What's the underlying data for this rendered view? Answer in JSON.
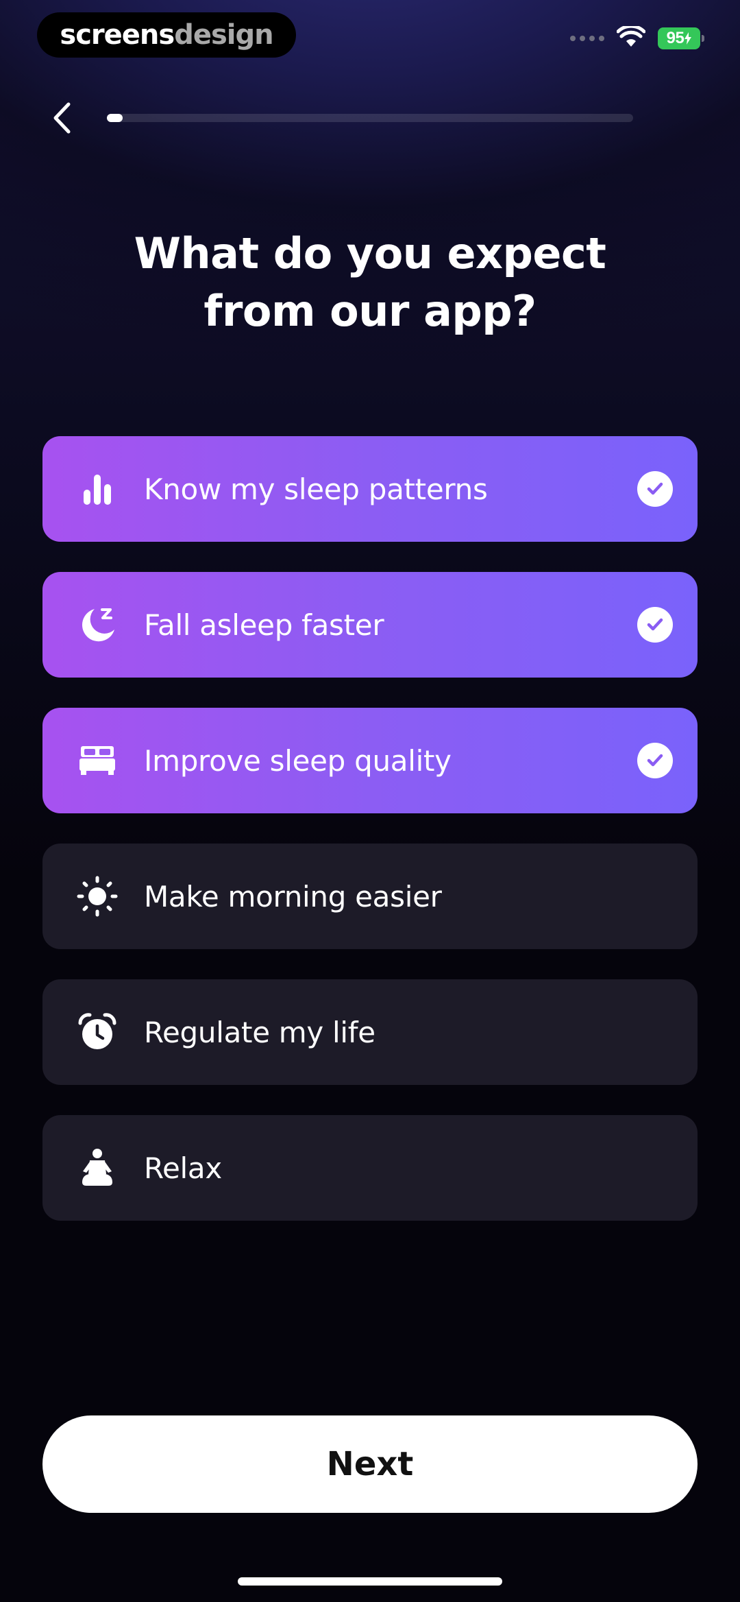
{
  "status_bar": {
    "brand_part1": "screens",
    "brand_part2": "design",
    "battery_text": "95",
    "battery_color": "#34c759"
  },
  "header": {
    "back_icon": "chevron-left-icon",
    "progress_fraction": 0.03
  },
  "title": {
    "line1": "What do you expect",
    "line2": "from our app?"
  },
  "options": [
    {
      "label": "Know my sleep patterns",
      "icon": "bar-chart-icon",
      "selected": true
    },
    {
      "label": "Fall asleep faster",
      "icon": "moon-sleep-icon",
      "selected": true
    },
    {
      "label": "Improve sleep quality",
      "icon": "bed-icon",
      "selected": true
    },
    {
      "label": "Make morning easier",
      "icon": "sun-icon",
      "selected": false
    },
    {
      "label": "Regulate my life",
      "icon": "alarm-clock-icon",
      "selected": false
    },
    {
      "label": "Relax",
      "icon": "meditation-icon",
      "selected": false
    }
  ],
  "colors": {
    "selected_gradient_start": "#a752f0",
    "selected_gradient_end": "#7a62fb",
    "unselected_bg": "#1d1b28",
    "check_mark": "#8a5cf3"
  },
  "next_button": {
    "label": "Next"
  }
}
